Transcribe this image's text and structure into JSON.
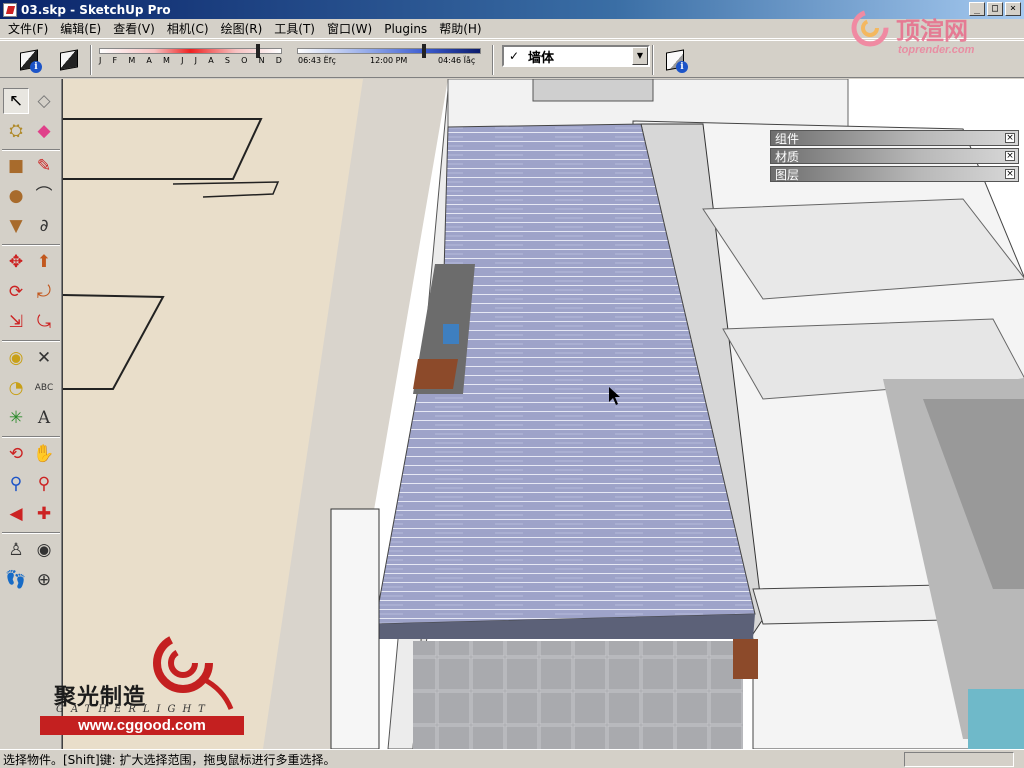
{
  "window": {
    "title": "03.skp - SketchUp Pro",
    "min_symbol": "_",
    "max_symbol": "□",
    "close_symbol": "×"
  },
  "menu": [
    "文件(F)",
    "编辑(E)",
    "查看(V)",
    "相机(C)",
    "绘图(R)",
    "工具(T)",
    "窗口(W)",
    "Plugins",
    "帮助(H)"
  ],
  "toolbar": {
    "months": [
      "J",
      "F",
      "M",
      "A",
      "M",
      "J",
      "J",
      "A",
      "S",
      "O",
      "N",
      "D"
    ],
    "months_position": 0.87,
    "time_labels": [
      "06:43 Ëfç",
      "12:00 PM",
      "04:46 Ïåç"
    ],
    "time_position": 0.69,
    "layer_check": "✓",
    "layer_name": "墙体",
    "info_glyph": "i"
  },
  "panels": [
    {
      "title": "组件",
      "close": "×"
    },
    {
      "title": "材质",
      "close": "×"
    },
    {
      "title": "图层",
      "close": "×"
    }
  ],
  "watermark": {
    "chinese": "聚光制造",
    "english": "GATHERLIGHT",
    "url": "www.cggood.com"
  },
  "brand": {
    "chinese": "顶渲网",
    "url": "toprender.com"
  },
  "status": {
    "text": "选择物件。[Shift]键: 扩大选择范围，拖曳鼠标进行多重选择。"
  },
  "colors": {
    "roof": "#9ea3c9",
    "ground": "#e9deca",
    "titlebar": "#0a246a",
    "accent_red": "#c42020"
  }
}
